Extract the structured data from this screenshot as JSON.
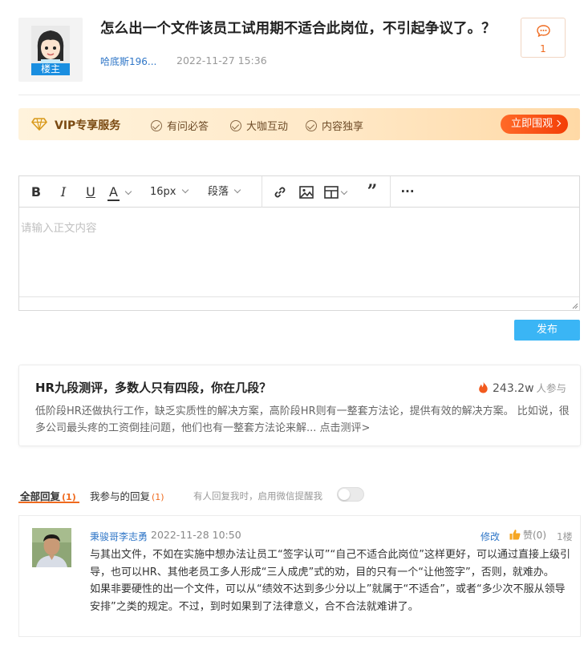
{
  "question": {
    "title": "怎么出一个文件该员工试用期不适合此岗位，不引起争议了。？",
    "author": "哈底斯196...",
    "time": "2022-11-27 15:36",
    "owner_badge": "楼主",
    "comment_count": "1"
  },
  "vip": {
    "title": "VIP专享服务",
    "features": [
      "有问必答",
      "大咖互动",
      "内容独享"
    ],
    "button": "立即围观"
  },
  "editor": {
    "font_size": "16px",
    "paragraph": "段落",
    "placeholder": "请输入正文内容",
    "publish_label": "发布"
  },
  "hr_card": {
    "title": "HR九段测评，多数人只有四段，你在几段？",
    "count": "243.2w",
    "count_unit": "人参与",
    "description": "低阶段HR还做执行工作，缺乏实质性的解决方案，高阶段HR则有一整套方法论，提供有效的解决方案。 比如说，很多公司最头疼的工资倒挂问题，他们也有一整套方法论来解... 点击测评>"
  },
  "tabs": {
    "all_label": "全部回复",
    "all_count": "(1)",
    "mine_label": "我参与的回复",
    "mine_count": "(1)",
    "notify_text": "有人回复我时，启用微信提醒我"
  },
  "reply": {
    "author": "秉骏哥李志勇",
    "time": "2022-11-28 10:50",
    "edit_label": "修改",
    "like_label": "赞(0)",
    "floor": "1楼",
    "paragraphs": [
      "与其出文件，不如在实施中想办法让员工“签字认可”“自己不适合此岗位”这样更好，可以通过直接上级引导，也可以HR、其他老员工多人形成“三人成虎”式的劝，目的只有一个“让他签字”，否则，就难办。",
      "如果非要硬性的出一个文件，可以从“绩效不达到多少分以上”就属于“不适合”，或者“多少次不服从领导安排”之类的规定。不过，到时如果到了法律意义，合不合法就难讲了。"
    ]
  },
  "colors": {
    "accent": "#ef6a1e",
    "link": "#2f76c7",
    "publish": "#3ab5f5",
    "vip_button": "#f33f07"
  },
  "icons": {
    "comment": "chat-bubble-icon",
    "vip": "diamond-icon",
    "fire": "fire-icon",
    "like": "thumbs-up-icon"
  }
}
